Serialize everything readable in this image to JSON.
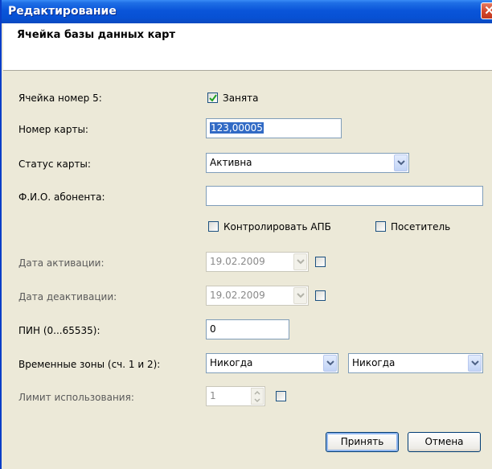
{
  "window": {
    "title": "Редактирование",
    "close_glyph": "✕"
  },
  "header": {
    "title": "Ячейка базы данных карт"
  },
  "fields": {
    "cell_label": "Ячейка номер 5:",
    "occupied_label": "Занята",
    "occupied_checked": true,
    "card_number_label": "Номер карты:",
    "card_number_value": "123,00005",
    "status_label": "Статус карты:",
    "status_value": "Активна",
    "fio_label": "Ф.И.О. абонента:",
    "fio_value": "",
    "control_apb_label": "Контролировать АПБ",
    "control_apb_checked": false,
    "visitor_label": "Посетитель",
    "visitor_checked": false,
    "activation_label": "Дата активации:",
    "activation_value": "19.02.2009",
    "activation_checked": false,
    "deactivation_label": "Дата деактивации:",
    "deactivation_value": "19.02.2009",
    "deactivation_checked": false,
    "pin_label": "ПИН (0...65535):",
    "pin_value": "0",
    "timezones_label": "Временные зоны (сч. 1 и 2):",
    "timezone1_value": "Никогда",
    "timezone2_value": "Никогда",
    "limit_label": "Лимит использования:",
    "limit_value": "1",
    "limit_checked": false
  },
  "buttons": {
    "accept": "Принять",
    "cancel": "Отмена"
  },
  "icons": {
    "close": "close-icon",
    "dropdown": "chevron-down-icon",
    "check": "check-icon",
    "spin": "spinner-arrows-icon"
  },
  "colors": {
    "titlebar": "#0a55d9",
    "dialog_bg": "#ece9d8",
    "selection": "#316ac5",
    "close": "#d3462b"
  }
}
